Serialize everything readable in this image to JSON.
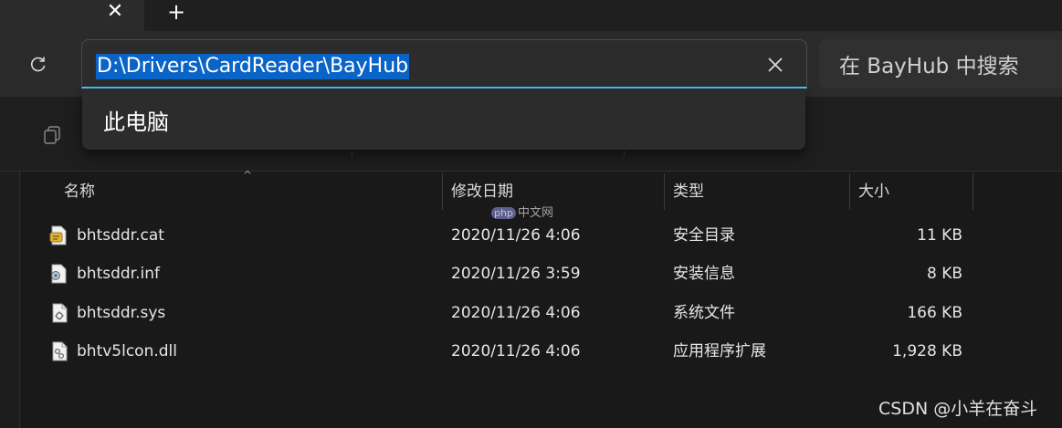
{
  "tabs": {
    "close_glyph": "✕",
    "new_tab_glyph": "+"
  },
  "address_bar": {
    "path": "D:\\Drivers\\CardReader\\BayHub",
    "clear_glyph": "✕"
  },
  "search": {
    "placeholder": "在 BayHub 中搜索"
  },
  "suggestions": [
    "此电脑"
  ],
  "columns": {
    "name": "名称",
    "modified": "修改日期",
    "type": "类型",
    "size": "大小"
  },
  "files": [
    {
      "name": "bhtsddr.cat",
      "modified": "2020/11/26 4:06",
      "type": "安全目录",
      "size": "11 KB",
      "icon": "security-catalog-icon"
    },
    {
      "name": "bhtsddr.inf",
      "modified": "2020/11/26 3:59",
      "type": "安装信息",
      "size": "8 KB",
      "icon": "setup-info-file-icon"
    },
    {
      "name": "bhtsddr.sys",
      "modified": "2020/11/26 4:06",
      "type": "系统文件",
      "size": "166 KB",
      "icon": "system-file-icon"
    },
    {
      "name": "bhtv5lcon.dll",
      "modified": "2020/11/26 4:06",
      "type": "应用程序扩展",
      "size": "1,928 KB",
      "icon": "dll-file-icon"
    }
  ],
  "watermarks": {
    "logo_left": "php",
    "logo_right": "中文网",
    "csdn": "CSDN @小羊在奋斗"
  },
  "colors": {
    "accent": "#4cc2ff",
    "selection": "#0a64c8",
    "background": "#191919"
  }
}
